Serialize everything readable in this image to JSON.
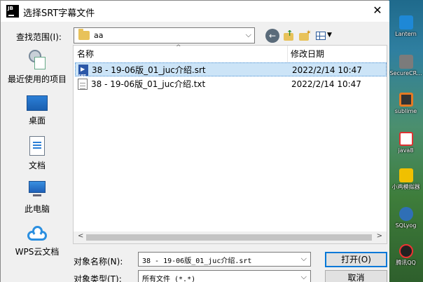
{
  "dialog": {
    "app_logo": "JB",
    "title": "选择SRT字幕文件",
    "close_label": "✕"
  },
  "toolbar": {
    "look_in_label": "查找范围(I):",
    "look_in_value": "aa",
    "look_in_dropdown": "⌵",
    "back_icon": "back-arrow-icon",
    "up_icon": "up-folder-icon",
    "new_folder_icon": "new-folder-icon",
    "view_menu_icon": "view-menu-icon"
  },
  "places": [
    {
      "label": "最近使用的项目",
      "icon": "recent-items-icon"
    },
    {
      "label": "桌面",
      "icon": "desktop-icon"
    },
    {
      "label": "文档",
      "icon": "documents-icon"
    },
    {
      "label": "此电脑",
      "icon": "this-pc-icon"
    },
    {
      "label": "WPS云文档",
      "icon": "wps-cloud-icon"
    }
  ],
  "file_list": {
    "columns": [
      "名称",
      "修改日期"
    ],
    "rows": [
      {
        "name": "38 - 19-06版_01_juc介绍.srt",
        "date": "2022/2/14 10:47",
        "type_icon": "srt-file-icon",
        "selected": true
      },
      {
        "name": "38 - 19-06版_01_juc介绍.txt",
        "date": "2022/2/14 10:47",
        "type_icon": "text-file-icon",
        "selected": false
      }
    ],
    "scroll_left": "<",
    "scroll_right": ">"
  },
  "filename": {
    "label": "对象名称(N):",
    "value": "38 - 19-06版_01_juc介绍.srt"
  },
  "filetype": {
    "label": "对象类型(T):",
    "value": "所有文件 (*.*)"
  },
  "buttons": {
    "open": "打开(O)",
    "cancel": "取消"
  },
  "desktop_icons": [
    {
      "label": "Lantern",
      "color": "#1e88d6"
    },
    {
      "label": "SecureCR...",
      "color": "#7b7b7b"
    },
    {
      "label": "sublime",
      "color": "#e57a24"
    },
    {
      "label": "java8",
      "color": "#ffffff"
    },
    {
      "label": "小鸡模拟器",
      "color": "#f0c000"
    },
    {
      "label": "SQLyog",
      "color": "#2f6fb6"
    },
    {
      "label": "腾讯QQ",
      "color": "#222222"
    }
  ]
}
